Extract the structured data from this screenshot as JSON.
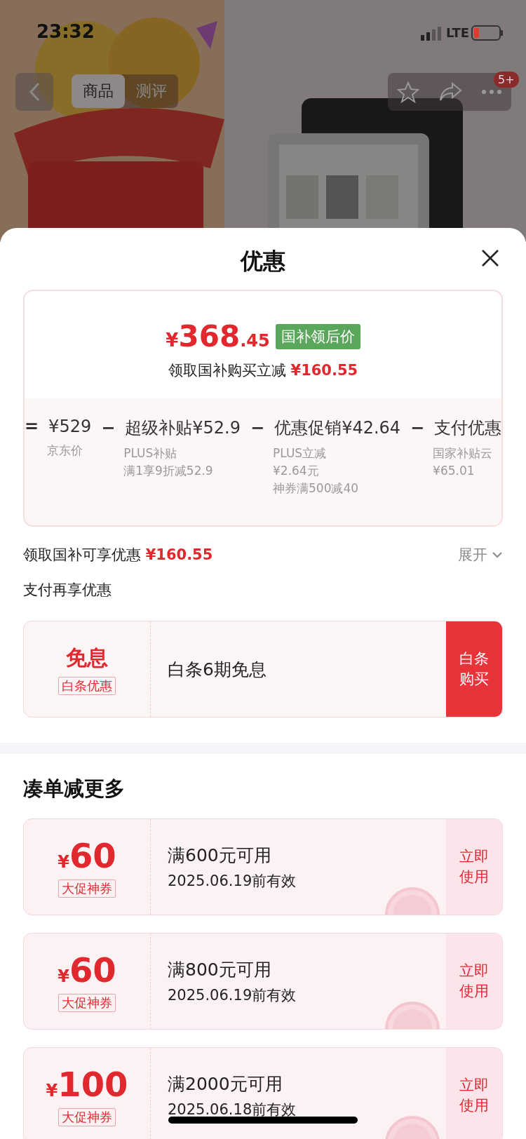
{
  "status_bar": {
    "time": "23:32",
    "network": "LTE"
  },
  "nav": {
    "tabs": [
      {
        "label": "商品",
        "selected": true
      },
      {
        "label": "测评",
        "selected": false
      }
    ],
    "badge": "5+"
  },
  "sheet": {
    "title": "优惠",
    "price_card": {
      "currency": "¥",
      "integer": "368",
      "decimal": ".45",
      "tag": "国补领后价",
      "saving_label": "领取国补购买立减",
      "saving_amount": "¥160.55",
      "terms": [
        {
          "op": "=",
          "label": "¥529",
          "notes": [
            "京东价"
          ]
        },
        {
          "op": "−",
          "label": "超级补贴¥52.9",
          "notes": [
            "PLUS补贴",
            "满1享9折减52.9"
          ]
        },
        {
          "op": "−",
          "label": "优惠促销¥42.64",
          "notes": [
            "PLUS立减",
            "¥2.64元",
            "神券满500减40"
          ]
        },
        {
          "op": "−",
          "label": "支付优惠",
          "notes": [
            "国家补贴云",
            "¥65.01"
          ]
        }
      ]
    },
    "summary": {
      "label": "领取国补可享优惠",
      "amount": "¥160.55",
      "toggle": "展开"
    },
    "payment_title": "支付再享优惠",
    "payment_offer": {
      "title": "免息",
      "tag": "白条优惠",
      "text": "白条6期免息",
      "action": "白条购买"
    },
    "section_title": "凑单减更多",
    "coupons": [
      {
        "currency": "¥",
        "amount": "60",
        "tag": "大促神券",
        "condition": "满600元可用",
        "validity": "2025.06.19前有效",
        "action": "立即使用",
        "claimed": true
      },
      {
        "currency": "¥",
        "amount": "60",
        "tag": "大促神券",
        "condition": "满800元可用",
        "validity": "2025.06.19前有效",
        "action": "立即使用",
        "claimed": true
      },
      {
        "currency": "¥",
        "amount": "100",
        "tag": "大促神券",
        "condition": "满2000元可用",
        "validity": "2025.06.18前有效",
        "action": "立即使用",
        "claimed": true
      }
    ]
  }
}
